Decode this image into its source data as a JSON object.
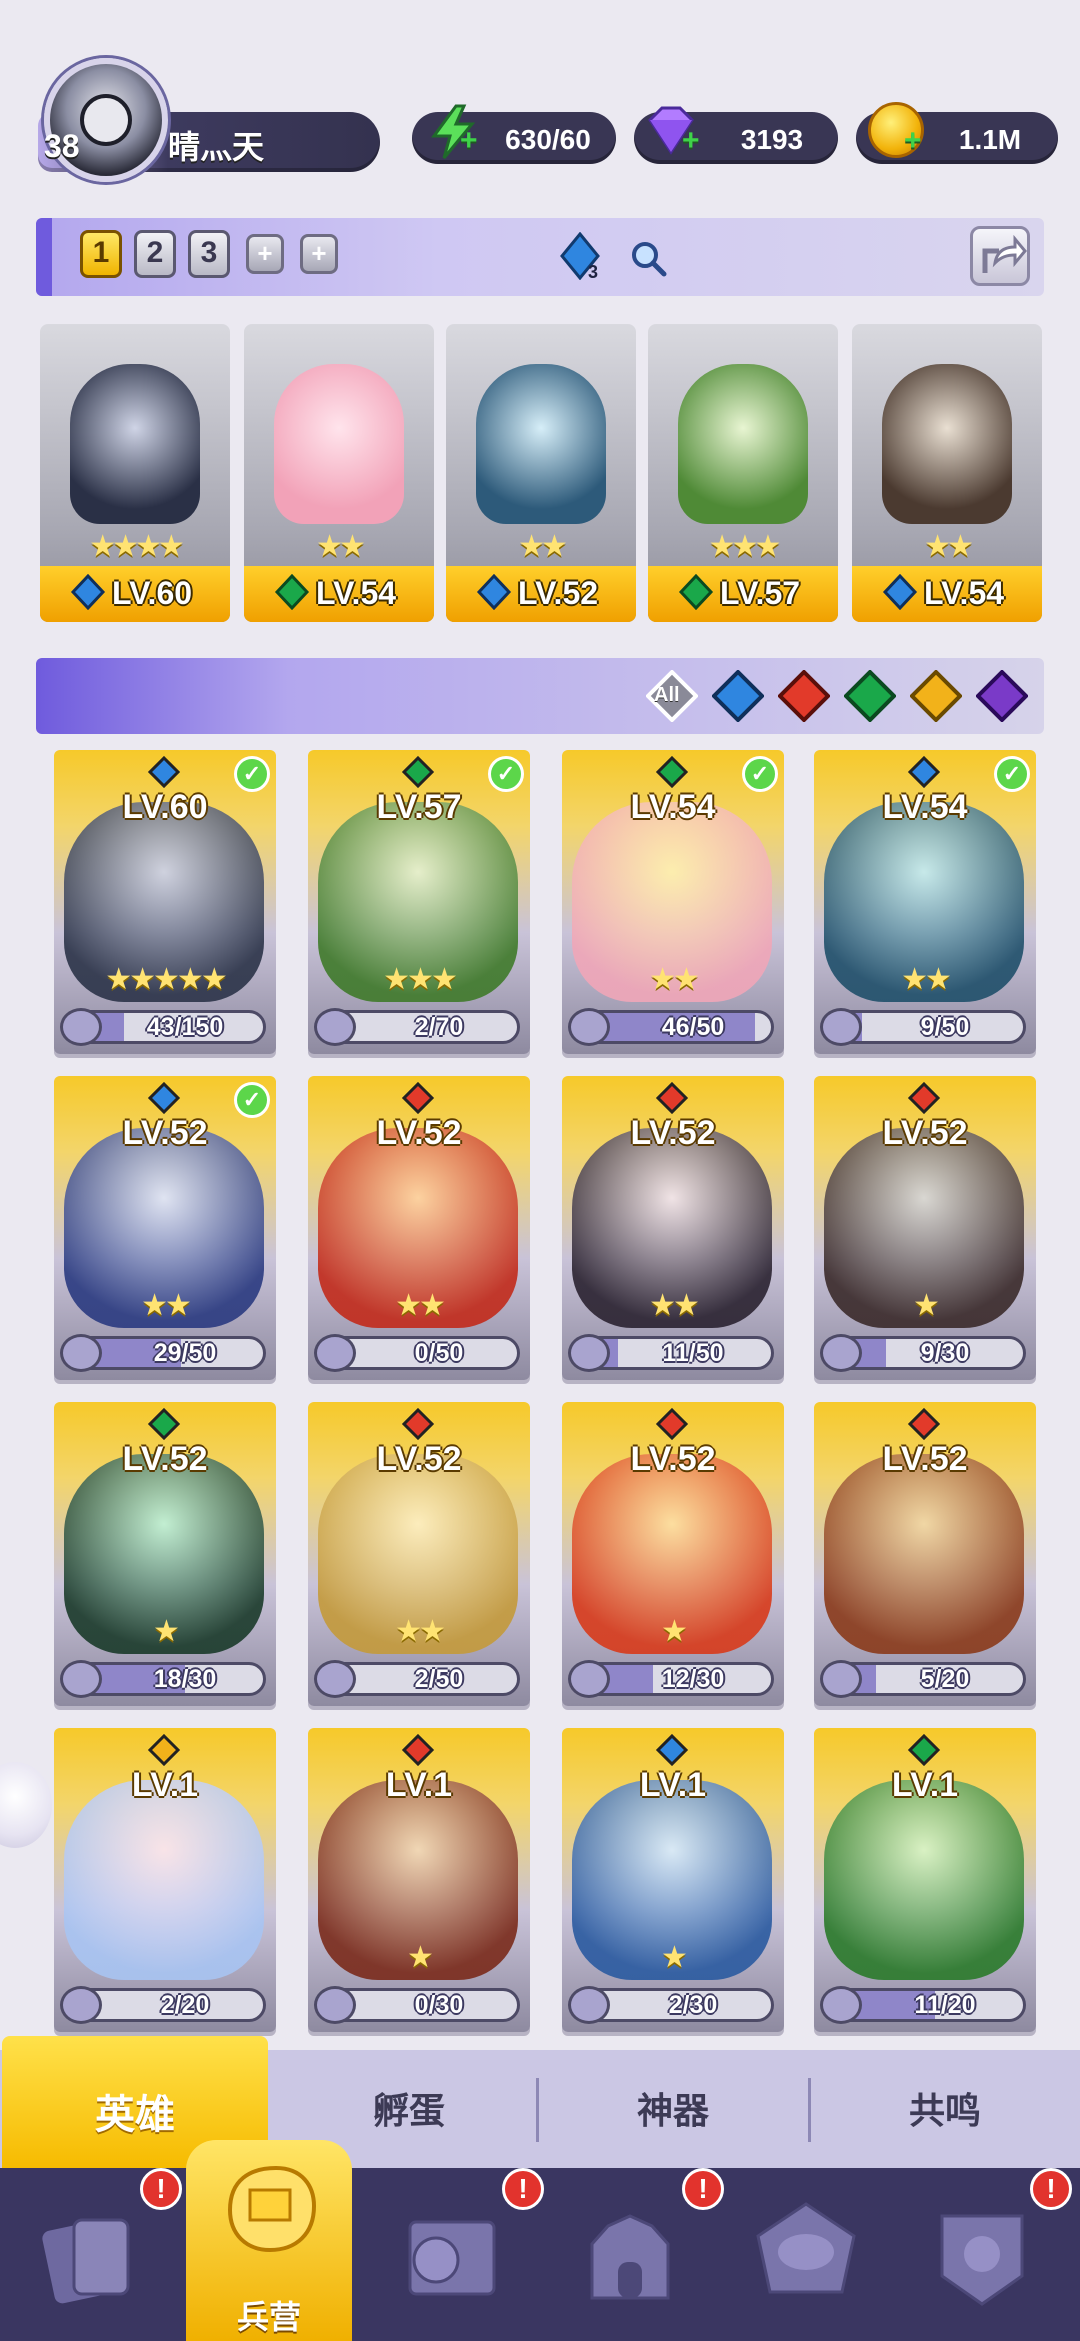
{
  "player": {
    "level": "38",
    "name": "晴灬天",
    "energy": "630/60",
    "gems": "3193",
    "coins": "1.1M"
  },
  "team": {
    "tabs": [
      "1",
      "2",
      "3"
    ],
    "plus": "+",
    "badge_count": "3",
    "active_tab": "1"
  },
  "squad": [
    {
      "level": "LV.60",
      "stars": "★★★★",
      "element": "water"
    },
    {
      "level": "LV.54",
      "stars": "★★",
      "element": "wind"
    },
    {
      "level": "LV.52",
      "stars": "★★",
      "element": "water"
    },
    {
      "level": "LV.57",
      "stars": "★★★",
      "element": "wind"
    },
    {
      "level": "LV.54",
      "stars": "★★",
      "element": "water"
    }
  ],
  "filters": {
    "all_label": "All",
    "elements": [
      "water",
      "fire",
      "wind",
      "light",
      "dark"
    ]
  },
  "heroes": [
    {
      "level": "LV.60",
      "progress": "43/150",
      "fraction": 0.29,
      "stars": "★★★★★",
      "element": "water",
      "in_team": true
    },
    {
      "level": "LV.57",
      "progress": "2/70",
      "fraction": 0.03,
      "stars": "★★★",
      "element": "wind",
      "in_team": true
    },
    {
      "level": "LV.54",
      "progress": "46/50",
      "fraction": 0.92,
      "stars": "★★",
      "element": "wind",
      "in_team": true
    },
    {
      "level": "LV.54",
      "progress": "9/50",
      "fraction": 0.18,
      "stars": "★★",
      "element": "water",
      "in_team": true
    },
    {
      "level": "LV.52",
      "progress": "29/50",
      "fraction": 0.58,
      "stars": "★★",
      "element": "water",
      "in_team": true
    },
    {
      "level": "LV.52",
      "progress": "0/50",
      "fraction": 0.0,
      "stars": "★★",
      "element": "fire",
      "in_team": false
    },
    {
      "level": "LV.52",
      "progress": "11/50",
      "fraction": 0.22,
      "stars": "★★",
      "element": "fire",
      "in_team": false
    },
    {
      "level": "LV.52",
      "progress": "9/30",
      "fraction": 0.3,
      "stars": "★",
      "element": "fire",
      "in_team": false
    },
    {
      "level": "LV.52",
      "progress": "18/30",
      "fraction": 0.6,
      "stars": "★",
      "element": "wind",
      "in_team": false
    },
    {
      "level": "LV.52",
      "progress": "2/50",
      "fraction": 0.04,
      "stars": "★★",
      "element": "fire",
      "in_team": false
    },
    {
      "level": "LV.52",
      "progress": "12/30",
      "fraction": 0.4,
      "stars": "★",
      "element": "fire",
      "in_team": false
    },
    {
      "level": "LV.52",
      "progress": "5/20",
      "fraction": 0.25,
      "stars": "",
      "element": "fire",
      "in_team": false
    },
    {
      "level": "LV.1",
      "progress": "2/20",
      "fraction": 0.1,
      "stars": "",
      "element": "light",
      "in_team": false
    },
    {
      "level": "LV.1",
      "progress": "0/30",
      "fraction": 0.0,
      "stars": "★",
      "element": "fire",
      "in_team": false
    },
    {
      "level": "LV.1",
      "progress": "2/30",
      "fraction": 0.07,
      "stars": "★",
      "element": "water",
      "in_team": false
    },
    {
      "level": "LV.1",
      "progress": "11/20",
      "fraction": 0.55,
      "stars": "",
      "element": "wind",
      "in_team": false
    }
  ],
  "subtabs": [
    "英雄",
    "孵蛋",
    "神器",
    "共鸣"
  ],
  "nav": {
    "active_label": "兵营",
    "alert": "!"
  },
  "colors": {
    "water": "#2f86e0",
    "fire": "#e23a2a",
    "wind": "#1aa84a",
    "light": "#f2b21a",
    "dark": "#7a3ac8",
    "accent": "#6f5bdd",
    "gold": "#f6c000"
  }
}
